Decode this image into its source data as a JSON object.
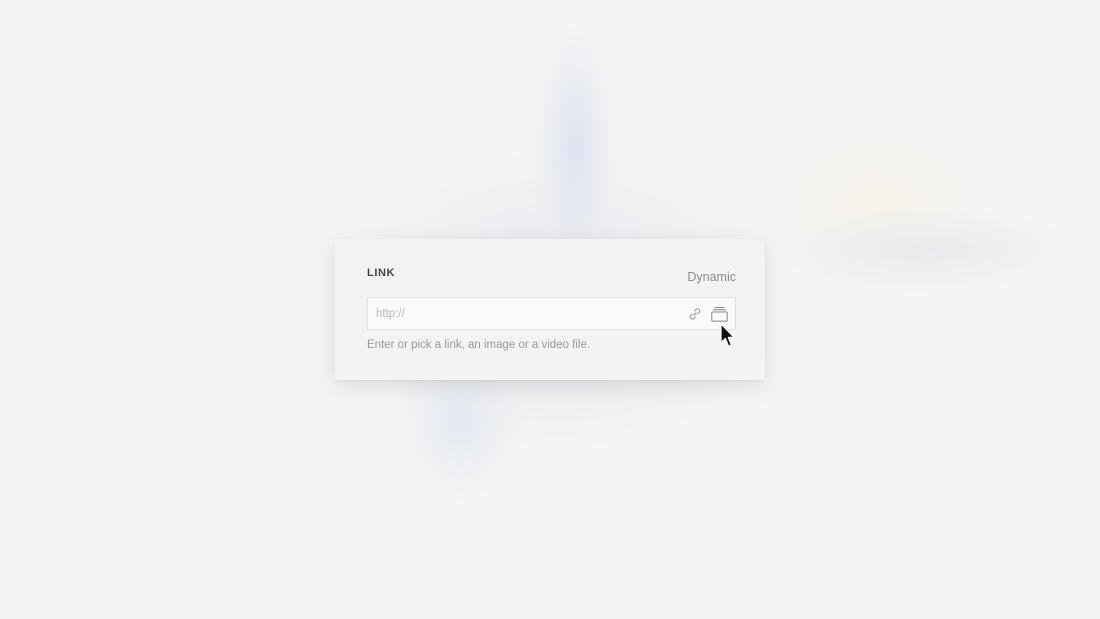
{
  "link_panel": {
    "label": "LINK",
    "dynamic_label": "Dynamic",
    "url_placeholder": "http://",
    "url_value": "",
    "help_text": "Enter or pick a link, an image or a video file.",
    "icons": {
      "link": "link-icon",
      "library": "media-library-icon"
    }
  },
  "colors": {
    "background": "#f4f4f4",
    "card": "#f3f3f3",
    "input_bg": "#fafafa",
    "label": "#444444",
    "muted": "#8a8a8a"
  }
}
